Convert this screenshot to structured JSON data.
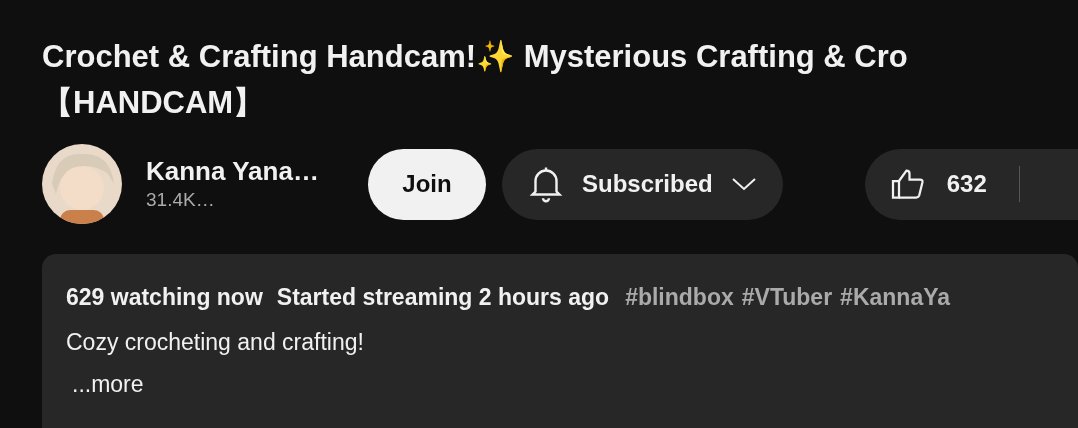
{
  "title_lines": [
    "Crochet & Crafting Handcam!✨ Mysterious Crafting & Cro",
    "【HANDCAM】"
  ],
  "channel": {
    "name": "Kanna Yana…",
    "subscribers": "31.4K…"
  },
  "join_button": "Join",
  "subscribe_button": {
    "label": "Subscribed",
    "subscribed": true
  },
  "like_button": {
    "count": "632"
  },
  "description": {
    "stats": [
      "629 watching now",
      "Started streaming 2 hours ago"
    ],
    "hashtags": [
      "#blindbox",
      "#VTuber",
      "#KannaYa"
    ],
    "text": "Cozy crocheting and crafting!",
    "more": "...more"
  }
}
